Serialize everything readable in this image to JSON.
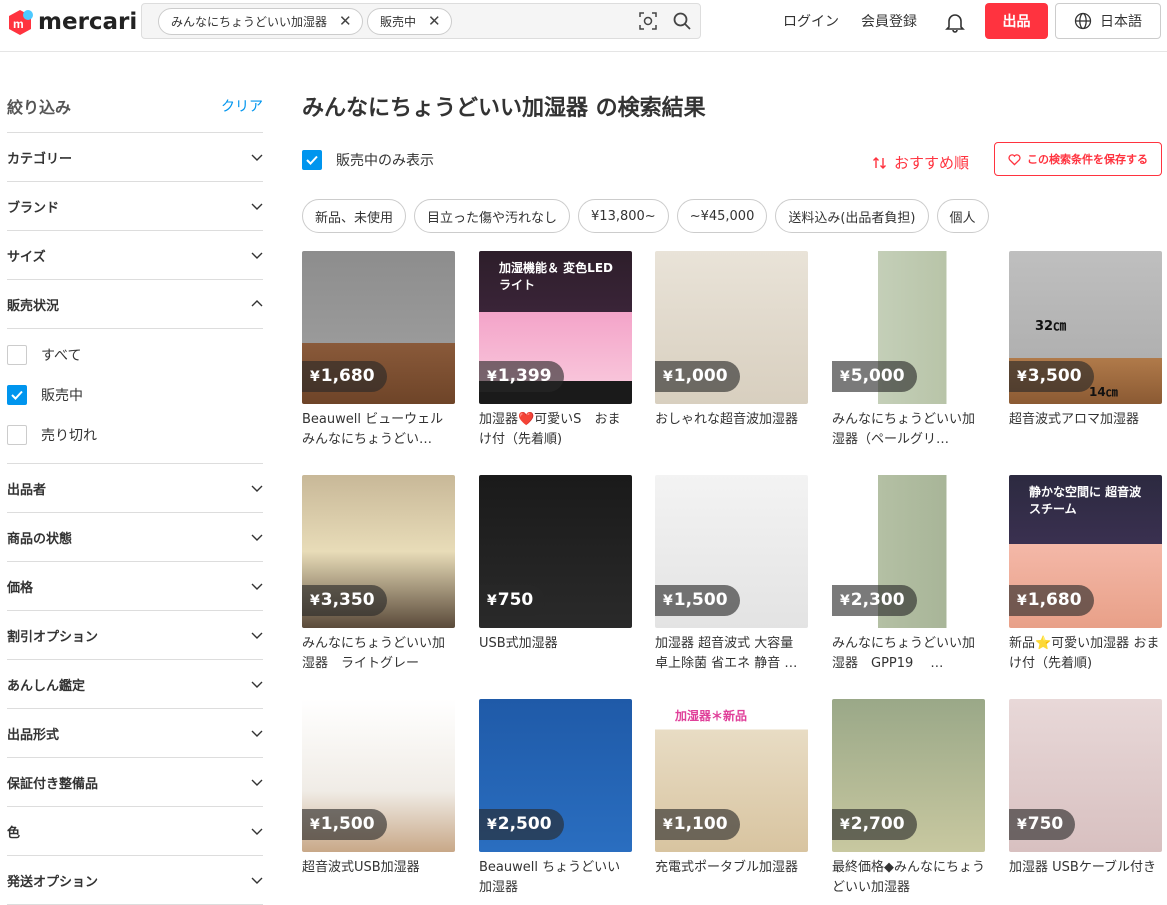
{
  "brand": {
    "name": "mercari"
  },
  "search": {
    "chips": [
      {
        "label": "みんなにちょうどいい加湿器"
      },
      {
        "label": "販売中"
      }
    ]
  },
  "header": {
    "login": "ログイン",
    "signup": "会員登録",
    "sell": "出品",
    "language": "日本語"
  },
  "filters": {
    "title": "絞り込み",
    "clear": "クリア",
    "sections_top": [
      "カテゴリー",
      "ブランド",
      "サイズ"
    ],
    "sale_status": {
      "label": "販売状況",
      "options": [
        {
          "label": "すべて",
          "checked": false
        },
        {
          "label": "販売中",
          "checked": true
        },
        {
          "label": "売り切れ",
          "checked": false
        }
      ]
    },
    "sections_bottom": [
      "出品者",
      "商品の状態",
      "価格",
      "割引オプション",
      "あんしん鑑定",
      "出品形式",
      "保証付き整備品",
      "色",
      "発送オプション"
    ]
  },
  "results": {
    "title": "みんなにちょうどいい加湿器 の検索結果",
    "on_sale_only": "販売中のみ表示",
    "sort": "おすすめ順",
    "save_search": "この検索条件を保存する",
    "chips": [
      "新品、未使用",
      "目立った傷や汚れなし",
      "¥13,800~",
      "~¥45,000",
      "送料込み(出品者負担)",
      "個人"
    ]
  },
  "items": [
    {
      "price": "1,680",
      "title": "Beauwell ビューウェル みんなにちょうどい…"
    },
    {
      "price": "1,399",
      "title": "加湿器❤️可愛いS　おまけ付（先着順)",
      "overlay": "加湿機能＆ 変色LEDライト"
    },
    {
      "price": "1,000",
      "title": "おしゃれな超音波加湿器"
    },
    {
      "price": "5,000",
      "title": "みんなにちょうどいい加湿器（ペールグリ…"
    },
    {
      "price": "3,500",
      "title": "超音波式アロマ加湿器",
      "overlay": "32㎝",
      "overlay2": "14㎝"
    },
    {
      "price": "3,350",
      "title": "みんなにちょうどいい加湿器　ライトグレー"
    },
    {
      "price": "750",
      "title": "USB式加湿器"
    },
    {
      "price": "1,500",
      "title": "加湿器 超音波式 大容量 卓上除菌 省エネ 静音 …"
    },
    {
      "price": "2,300",
      "title": "みんなにちょうどいい加湿器　GPP19　 …"
    },
    {
      "price": "1,680",
      "title": "新品⭐️可愛い加湿器 おまけ付（先着順)",
      "overlay": "静かな空間に 超音波スチーム"
    },
    {
      "price": "1,500",
      "title": "超音波式USB加湿器"
    },
    {
      "price": "2,500",
      "title": "Beauwell ちょうどいい加湿器"
    },
    {
      "price": "1,100",
      "title": "充電式ポータブル加湿器",
      "overlay": "加湿器＊新品"
    },
    {
      "price": "2,700",
      "title": "最終価格◆みんなにちょうどいい加湿器"
    },
    {
      "price": "750",
      "title": "加湿器 USBケーブル付き"
    }
  ],
  "colors": {
    "accent": "#ff333f",
    "link": "#0095ee"
  }
}
